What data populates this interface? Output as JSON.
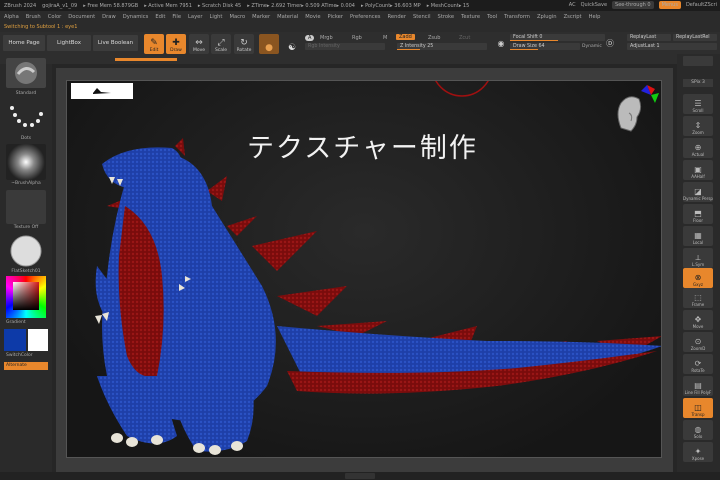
{
  "titlebar": {
    "app": "ZBrush 2024",
    "file": "gojiraA_v1_09",
    "free_mem": "▸ Free Mem 58.879GB",
    "active_mem": "▸ Active Mem 7951",
    "scratch": "▸ Scratch Disk 45",
    "ztime": "▸ ZTime▸ 2.692 Timer▸ 0.509 ATime▸ 0.004",
    "polycount": "▸ PolyCount▸ 36.603 MP",
    "meshcount": "▸ MeshCount▸ 15",
    "ac": "AC",
    "quicksave": "QuickSave",
    "seethrough": "See-through  0",
    "menus": "Menus",
    "defaultscript": "DefaultZScri"
  },
  "menubar": [
    "Alpha",
    "Brush",
    "Color",
    "Document",
    "Draw",
    "Dynamics",
    "Edit",
    "File",
    "Layer",
    "Light",
    "Macro",
    "Marker",
    "Material",
    "Movie",
    "Picker",
    "Preferences",
    "Render",
    "Stencil",
    "Stroke",
    "Texture",
    "Tool",
    "Transform",
    "Zplugin",
    "Zscript",
    "Help"
  ],
  "subtool_line": "Switching to Subtool 1 :  eye1",
  "shelf": {
    "home_page": "Home Page",
    "lightbox": "LightBox",
    "live_boolean": "Live Boolean",
    "edit": "Edit",
    "draw": "Draw",
    "move": "Move",
    "scale": "Scale",
    "rotate": "Rotate",
    "a_btn": "A",
    "mrgb": "Mrgb",
    "rgb": "Rgb",
    "m": "M",
    "zadd": "Zadd",
    "zsub": "Zsub",
    "zcut": "Zcut",
    "rgb_intensity": "Rgb Intensity",
    "z_intensity": "Z Intensity",
    "z_intensity_value": 25,
    "focal_shift": "Focal Shift",
    "focal_shift_value": 0,
    "draw_size": "Draw Size",
    "draw_size_value": 64,
    "dynamic": "Dynamic",
    "replaylast": "ReplayLast",
    "replaylastrel": "ReplayLastRel",
    "adjustlast": "AdjustLast",
    "adjustlast_value": 1
  },
  "leftpanel": {
    "standard": "Standard",
    "dots": "Dots",
    "brushalpha": "~BrushAlpha",
    "texture_off": "Texture Off",
    "matcap": "FlatSketch01",
    "gradient": "Gradient",
    "switchcolor": "SwitchColor",
    "alternate": "Alternate"
  },
  "viewport": {
    "overlay_text": "テクスチャー制作"
  },
  "rightpanel": {
    "spix": "SPix 3",
    "items": [
      "Scroll",
      "Zoom",
      "Actual",
      "AAHalf",
      "Dynamic Persp",
      "Floor",
      "Local",
      "L.Sym",
      "Gxyz",
      "Frame",
      "Move",
      "ZoomD",
      "RotaTe",
      "Line Fill PolyF",
      "Transp",
      "Solo",
      "Xpose"
    ]
  },
  "colors": {
    "accent": "#e8872c",
    "body_blue": "#1e3fa8",
    "fin_red": "#8c0f0f"
  }
}
